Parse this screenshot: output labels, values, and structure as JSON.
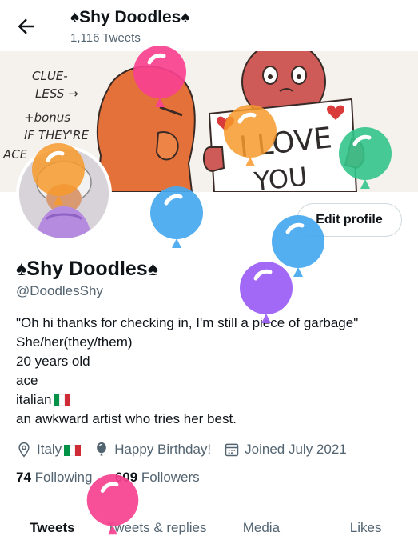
{
  "header": {
    "title": "♠Shy Doodles♠",
    "tweet_count": "1,116 Tweets"
  },
  "banner": {
    "left_doodle_lines": [
      "CLUE-",
      "LESS →",
      "+bonus",
      "IF THEY'RE",
      "ACE"
    ],
    "sign_text_1": "I LOVE",
    "sign_text_2": "YOU"
  },
  "actions": {
    "edit_profile": "Edit profile"
  },
  "profile": {
    "name": "♠Shy Doodles♠",
    "handle": "@DoodlesShy",
    "bio": [
      "\"Oh hi thanks for checking in, I'm still a piece of garbage\"",
      "She/her(they/them)",
      "20 years old",
      "ace",
      "italian",
      "an awkward artist who tries her best."
    ],
    "location": "Italy",
    "birthday": "Happy Birthday!",
    "joined": "Joined July 2021",
    "following_count": "74",
    "following_label": "Following",
    "followers_count": "609",
    "followers_label": "Followers"
  },
  "tabs": [
    {
      "label": "Tweets",
      "active": true
    },
    {
      "label": "Tweets & replies",
      "active": false
    },
    {
      "label": "Media",
      "active": false
    },
    {
      "label": "Likes",
      "active": false
    }
  ],
  "colors": {
    "flag_green": "#009246",
    "flag_white": "#ffffff",
    "flag_red": "#ce2b37",
    "balloon_pink": "#f7418f",
    "balloon_orange": "#f79a2b",
    "balloon_green": "#33c48a",
    "balloon_blue": "#45a8f0",
    "balloon_purple": "#9a5cf5"
  }
}
